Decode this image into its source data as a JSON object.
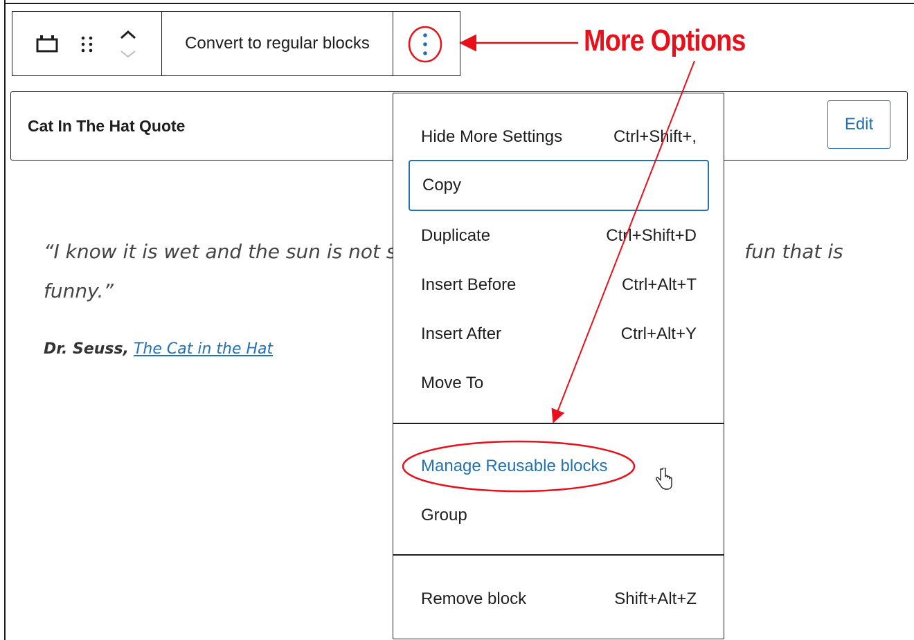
{
  "toolbar": {
    "convert_label": "Convert to regular blocks"
  },
  "block": {
    "title": "Cat In The Hat Quote",
    "edit_label": "Edit"
  },
  "quote": {
    "line1_left": "“I know it is wet and the sun is not su",
    "line1_right": "fun that is",
    "line2": "funny.”",
    "author": "Dr. Seuss,",
    "work": "The Cat in the Hat"
  },
  "menu": {
    "items": [
      {
        "label": "Hide More Settings",
        "shortcut": "Ctrl+Shift+,"
      },
      {
        "label": "Copy",
        "shortcut": ""
      },
      {
        "label": "Duplicate",
        "shortcut": "Ctrl+Shift+D"
      },
      {
        "label": "Insert Before",
        "shortcut": "Ctrl+Alt+T"
      },
      {
        "label": "Insert After",
        "shortcut": "Ctrl+Alt+Y"
      },
      {
        "label": "Move To",
        "shortcut": ""
      },
      {
        "label": "Manage Reusable blocks",
        "shortcut": ""
      },
      {
        "label": "Group",
        "shortcut": ""
      },
      {
        "label": "Remove block",
        "shortcut": "Shift+Alt+Z"
      }
    ]
  },
  "annotation": {
    "callout": "More Options",
    "color": "#e8101a"
  },
  "colors": {
    "accent": "#2271b1",
    "text": "#1e1e1e"
  }
}
